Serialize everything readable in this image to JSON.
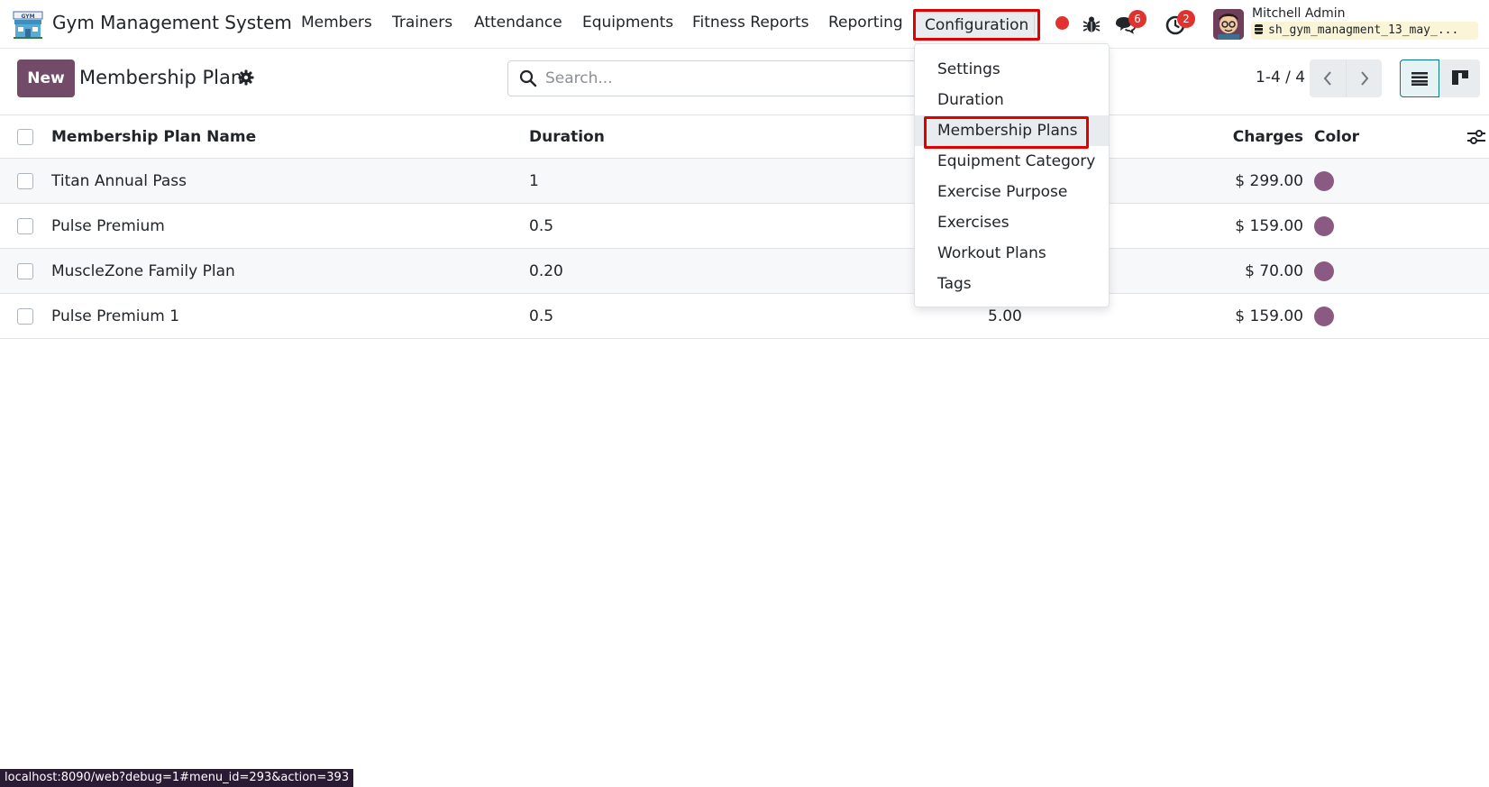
{
  "navbar": {
    "app_name": "Gym Management System",
    "menu": [
      {
        "label": "Members"
      },
      {
        "label": "Trainers"
      },
      {
        "label": "Attendance"
      },
      {
        "label": "Equipments"
      },
      {
        "label": "Fitness Reports"
      },
      {
        "label": "Reporting"
      },
      {
        "label": "Configuration"
      }
    ],
    "messages_badge": "6",
    "activities_badge": "2",
    "user_name": "Mitchell Admin",
    "database": "sh_gym_managment_13_may_..."
  },
  "control_panel": {
    "new_label": "New",
    "title": "Membership Plan",
    "search_placeholder": "Search...",
    "pager": "1-4 / 4"
  },
  "table": {
    "headers": {
      "name": "Membership Plan Name",
      "duration": "Duration",
      "charges": "Charges",
      "color": "Color"
    },
    "rows": [
      {
        "name": "Titan Annual Pass",
        "duration": "1",
        "mid": "",
        "charges": "$ 299.00"
      },
      {
        "name": "Pulse Premium",
        "duration": "0.5",
        "mid": "",
        "charges": "$ 159.00"
      },
      {
        "name": "MuscleZone Family Plan",
        "duration": "0.20",
        "mid": "",
        "charges": "$ 70.00"
      },
      {
        "name": "Pulse Premium 1",
        "duration": "0.5",
        "mid": "5.00",
        "charges": "$ 159.00"
      }
    ]
  },
  "dropdown": {
    "items": [
      {
        "label": "Settings"
      },
      {
        "label": "Duration"
      },
      {
        "label": "Membership Plans"
      },
      {
        "label": "Equipment Category"
      },
      {
        "label": "Exercise Purpose"
      },
      {
        "label": "Exercises"
      },
      {
        "label": "Workout Plans"
      },
      {
        "label": "Tags"
      }
    ]
  },
  "statusbar": {
    "url": "localhost:8090/web?debug=1#menu_id=293&action=393"
  },
  "colors": {
    "brand": "#714b67",
    "highlight": "#e00000",
    "plan_color": "#8b5a83",
    "badge": "#e0332f"
  }
}
